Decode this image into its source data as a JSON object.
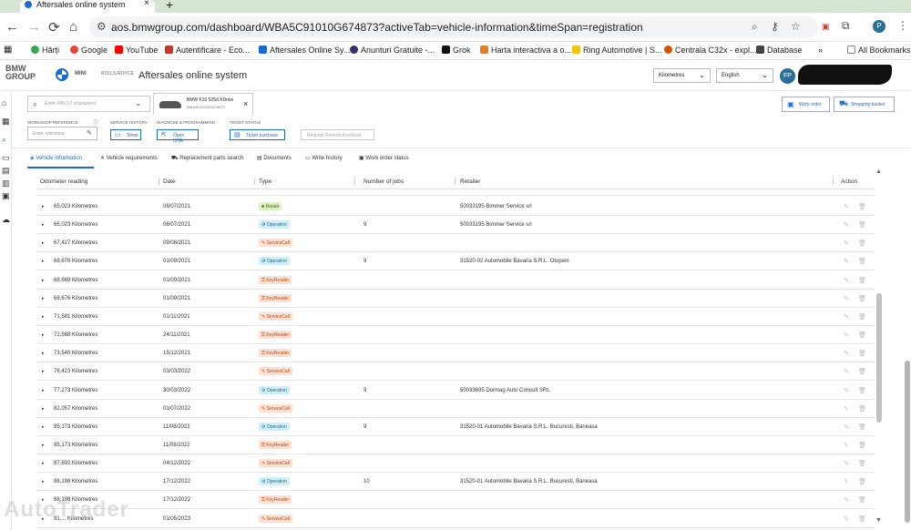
{
  "browser": {
    "tab_title": "Aftersales online system",
    "tab_close": "×",
    "new_tab": "+",
    "url": "aos.bmwgroup.com/dashboard/WBA5C91010G674873?activeTab=vehicle-information&timeSpan=registration",
    "profile_initial": "P",
    "icons": {
      "back": "←",
      "forward": "→",
      "reload": "⟳",
      "home": "⌂",
      "more": "⋮",
      "extensions": "⧉",
      "star": "☆",
      "zoom": "⌕"
    }
  },
  "bookmarks": [
    {
      "label": "Hărți",
      "color": "#34a853"
    },
    {
      "label": "Google",
      "color": "#ea4335"
    },
    {
      "label": "YouTube",
      "color": "#ff0000"
    },
    {
      "label": "Autentificare - Eco...",
      "color": "#c0392b"
    },
    {
      "label": "Aftersales Online Sy...",
      "color": "#1c69d4"
    },
    {
      "label": "Anunturi Gratuite -...",
      "color": "#3d2b6b"
    },
    {
      "label": "Grok",
      "color": "#111111"
    },
    {
      "label": "Harta interactiva a o...",
      "color": "#e67e22"
    },
    {
      "label": "Ring Automotive | S...",
      "color": "#f1c40f"
    },
    {
      "label": "Centrala C32x - expl...",
      "color": "#d35400"
    },
    {
      "label": "Database",
      "color": "#444444"
    },
    {
      "label": "»",
      "color": ""
    },
    {
      "label": "All Bookmarks",
      "color": "#888888"
    }
  ],
  "app": {
    "logo_line1": "BMW",
    "logo_line2": "GROUP",
    "mini": "MINI",
    "rolls": "ROLLS-ROYCE",
    "title": "Aftersales online system",
    "units_select": "Kilometres",
    "language_select": "English",
    "user_initials": "FP",
    "select_caret": "⌄"
  },
  "sidebar": {
    "icons": [
      "⌂",
      "▦",
      "⌕",
      "▭",
      "▤",
      "▥",
      "▣",
      "☁"
    ]
  },
  "vehicle_bar": {
    "vin_placeholder": "Enter VIN (17 characters)",
    "vehicle_model": "BMW F10 525d XDrive",
    "vehicle_vin": "WBA5C91010G674873",
    "close": "×",
    "work_order": "Work order",
    "shopping_basket": "Shopping basket"
  },
  "tools": {
    "workshop_reference_label": "WORKSHOP REFERENCE",
    "workshop_reference_placeholder": "Enter reference",
    "service_history_label": "SERVICE HISTORY",
    "show_button": "Show",
    "diagnose_label": "DIAGNOSE & PROGRAMMING",
    "open_ista_button": "Open ISTA",
    "ticket_status_label": "TICKET STATUS",
    "ticket_purchase_button": "Ticket purchase",
    "request_keyread_button": "Request Remote KeyRead"
  },
  "tabs": [
    {
      "label": "Vehicle information",
      "icon": "◈",
      "active": true
    },
    {
      "label": "Vehicle requirements",
      "icon": "✕",
      "active": false
    },
    {
      "label": "Replacement parts search",
      "icon": "⛟",
      "active": false
    },
    {
      "label": "Documents",
      "icon": "▤",
      "active": false
    },
    {
      "label": "Write history",
      "icon": "▭",
      "active": false
    },
    {
      "label": "Work order status",
      "icon": "▣",
      "active": false
    }
  ],
  "table": {
    "columns": [
      "Odometer reading",
      "Date",
      "Type",
      "Number of jobs",
      "Retailer",
      "Action"
    ],
    "rows": [
      {
        "odometer": "65,023 Kilometres",
        "date": "06/07/2021",
        "type": "Repair",
        "jobs": "",
        "retailer": "50033195 Bimmer Service srl"
      },
      {
        "odometer": "65,023 Kilometres",
        "date": "06/07/2021",
        "type": "Operation",
        "jobs": "9",
        "retailer": "50033195 Bimmer Service srl"
      },
      {
        "odometer": "67,427 Kilometres",
        "date": "09/08/2021",
        "type": "ServiceCall",
        "jobs": "",
        "retailer": ""
      },
      {
        "odometer": "68,676 Kilometres",
        "date": "01/09/2021",
        "type": "Operation",
        "jobs": "9",
        "retailer": "31520-02 Automobile Bavaria S.R.L. Otopeni"
      },
      {
        "odometer": "68,669 Kilometres",
        "date": "01/09/2021",
        "type": "KeyReader",
        "jobs": "",
        "retailer": ""
      },
      {
        "odometer": "68,676 Kilometres",
        "date": "01/09/2021",
        "type": "KeyReader",
        "jobs": "",
        "retailer": ""
      },
      {
        "odometer": "71,581 Kilometres",
        "date": "01/11/2021",
        "type": "ServiceCall",
        "jobs": "",
        "retailer": ""
      },
      {
        "odometer": "72,568 Kilometres",
        "date": "24/11/2021",
        "type": "KeyReader",
        "jobs": "",
        "retailer": ""
      },
      {
        "odometer": "73,540 Kilometres",
        "date": "15/12/2021",
        "type": "KeyReader",
        "jobs": "",
        "retailer": ""
      },
      {
        "odometer": "76,423 Kilometres",
        "date": "03/03/2022",
        "type": "ServiceCall",
        "jobs": "",
        "retailer": ""
      },
      {
        "odometer": "77,273 Kilometres",
        "date": "30/03/2022",
        "type": "Operation",
        "jobs": "9",
        "retailer": "50033695 Dormag Auto Consult SRL"
      },
      {
        "odometer": "82,057 Kilometres",
        "date": "01/07/2022",
        "type": "ServiceCall",
        "jobs": "",
        "retailer": ""
      },
      {
        "odometer": "85,173 Kilometres",
        "date": "11/08/2022",
        "type": "Operation",
        "jobs": "9",
        "retailer": "31520-01 Automobile Bavaria S.R.L. Bucuresti, Baneasa"
      },
      {
        "odometer": "85,173 Kilometres",
        "date": "11/08/2022",
        "type": "KeyReader",
        "jobs": "",
        "retailer": ""
      },
      {
        "odometer": "87,692 Kilometres",
        "date": "04/12/2022",
        "type": "ServiceCall",
        "jobs": "",
        "retailer": ""
      },
      {
        "odometer": "88,198 Kilometres",
        "date": "17/12/2022",
        "type": "Operation",
        "jobs": "10",
        "retailer": "31520-01 Automobile Bavaria S.R.L. Bucuresti, Baneasa"
      },
      {
        "odometer": "88,198 Kilometres",
        "date": "17/12/2022",
        "type": "KeyReader",
        "jobs": "",
        "retailer": ""
      },
      {
        "odometer": "91,... Kilometres",
        "date": "01/05/2023",
        "type": "ServiceCall",
        "jobs": "",
        "retailer": ""
      }
    ],
    "type_styles": {
      "Repair": {
        "bg": "#dff0c8",
        "fg": "#3c6e12",
        "icon": "♣"
      },
      "Operation": {
        "bg": "#cfeef7",
        "fg": "#1d6f8e",
        "icon": "⚙"
      },
      "ServiceCall": {
        "bg": "#fde0d0",
        "fg": "#b5471c",
        "icon": "✎"
      },
      "KeyReader": {
        "bg": "#fde0d0",
        "fg": "#b5471c",
        "icon": "⚿"
      }
    },
    "row_caret": "▸",
    "edit_icon": "✎",
    "delete_icon": "🗑"
  },
  "watermark": "AutoTrader"
}
